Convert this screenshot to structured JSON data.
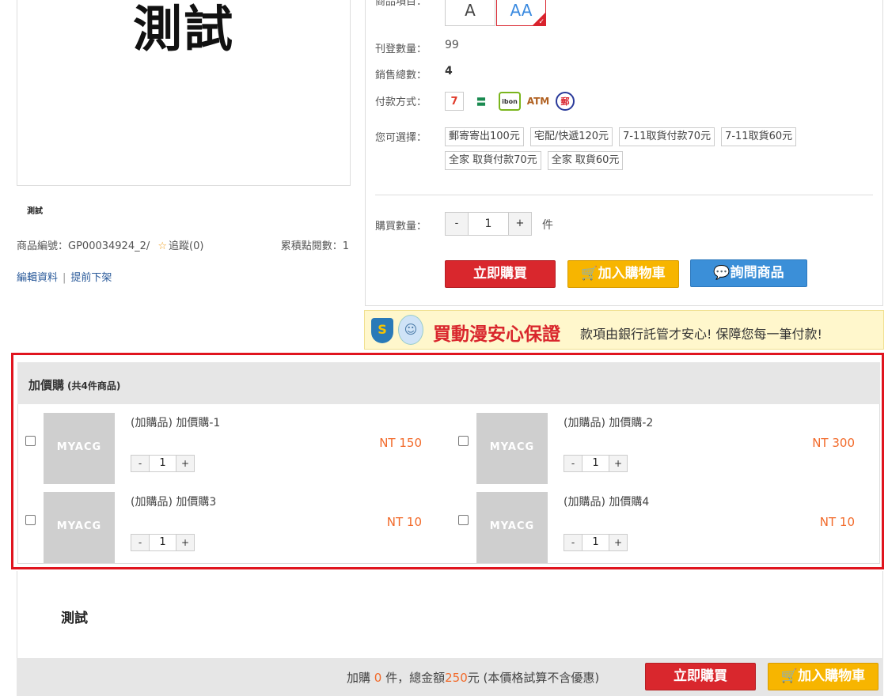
{
  "product": {
    "big_text": "測試",
    "thumb_caption": "測試",
    "code_label": "商品編號：",
    "code": "GP00034924_2/",
    "follow_label": "追蹤(0)",
    "points_label": "累積點閱數：",
    "points": "1",
    "edit_link": "編輯資料",
    "unlist_link": "提前下架"
  },
  "options": {
    "label": "商品項目：",
    "items": [
      "A",
      "AA"
    ],
    "selected": "AA"
  },
  "stock": {
    "label": "刊登數量：",
    "value": "99"
  },
  "sold": {
    "label": "銷售總數：",
    "value": "4"
  },
  "payment": {
    "label": "付款方式：",
    "icons": [
      {
        "name": "seven-eleven-icon",
        "glyph": "7"
      },
      {
        "name": "familymart-icon",
        "glyph": "〓"
      },
      {
        "name": "ibon-icon",
        "glyph": "ibon"
      },
      {
        "name": "atm-icon",
        "glyph": "ATM"
      },
      {
        "name": "post-office-icon",
        "glyph": "郵"
      }
    ]
  },
  "shipping": {
    "label": "您可選擇：",
    "options": [
      "郵寄寄出100元",
      "宅配/快遞120元",
      "7-11取貨付款70元",
      "7-11取貨60元",
      "全家 取貨付款70元",
      "全家 取貨60元"
    ]
  },
  "quantity": {
    "label": "購買數量：",
    "minus": "-",
    "value": "1",
    "plus": "+",
    "unit": "件"
  },
  "buttons": {
    "buy_now": "立即購買",
    "add_cart": "加入購物車",
    "ask": "詢問商品"
  },
  "banner": {
    "title": "買動漫安心保證",
    "subtitle": "款項由銀行託管才安心! 保障您每一筆付款!"
  },
  "addon": {
    "title": "加價購",
    "count": "(共4件商品)",
    "items": [
      {
        "placeholder": "MYACG",
        "name": "(加購品) 加價購-1",
        "price": "NT 150",
        "qty": "1"
      },
      {
        "placeholder": "MYACG",
        "name": "(加購品) 加價購-2",
        "price": "NT 300",
        "qty": "1"
      },
      {
        "placeholder": "MYACG",
        "name": "(加購品) 加價購3",
        "price": "NT 10",
        "qty": "1"
      },
      {
        "placeholder": "MYACG",
        "name": "(加購品) 加價購4",
        "price": "NT 10",
        "qty": "1"
      }
    ]
  },
  "description": {
    "text": "測試"
  },
  "footer": {
    "prefix": "加購",
    "count": "0",
    "mid": "件，總金額",
    "total": "250",
    "suffix": "元 (本價格試算不含優惠)",
    "buy_now": "立即購買",
    "add_cart": "加入購物車"
  },
  "colors": {
    "accent_red": "#d9272d",
    "button_yellow": "#f7b500",
    "button_blue": "#3b8fd8",
    "price_orange": "#f26a2a"
  }
}
